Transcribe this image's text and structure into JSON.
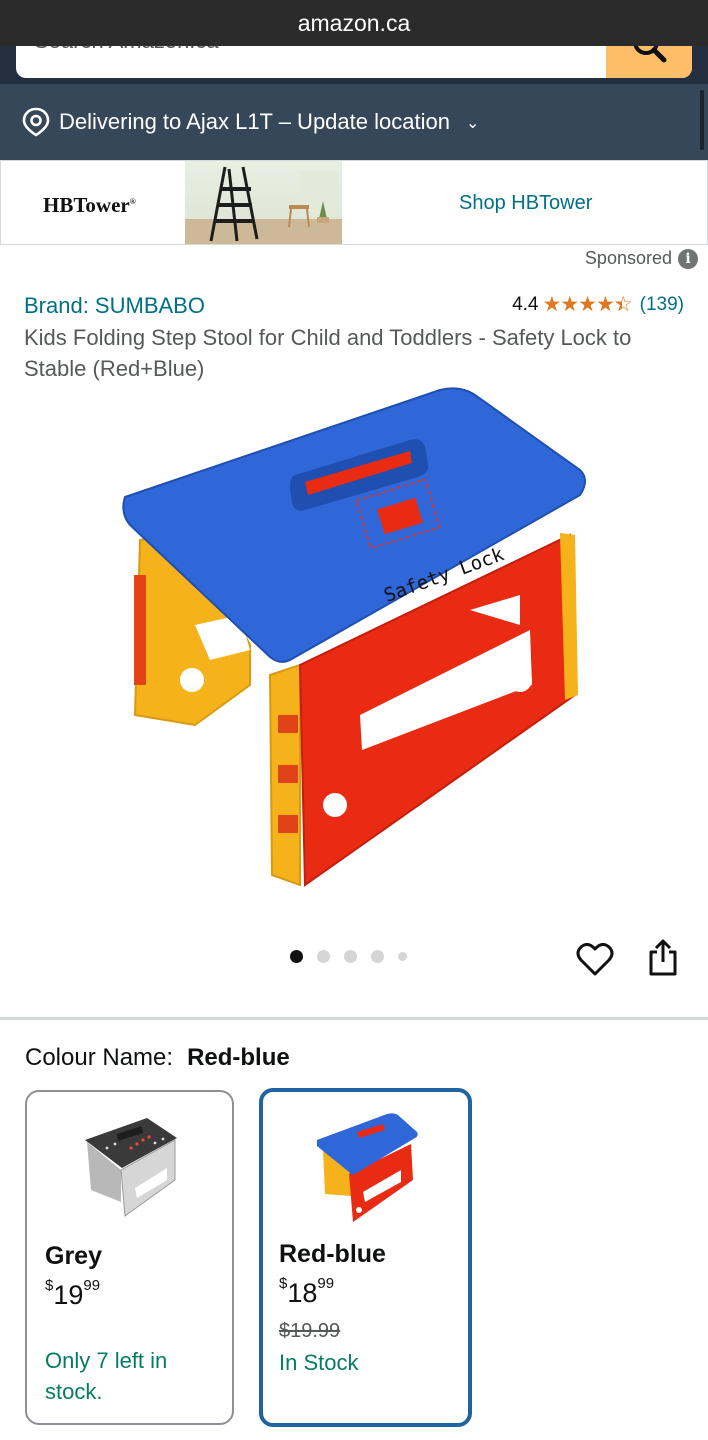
{
  "browser": {
    "url": "amazon.ca"
  },
  "search": {
    "placeholder": "Search Amazon.ca"
  },
  "delivery": {
    "text": "Delivering to Ajax L1T – Update location"
  },
  "ad": {
    "logo_text": "HBTower",
    "shop_link": "Shop HBTower",
    "sponsored_label": "Sponsored"
  },
  "product": {
    "brand": "Brand: SUMBABO",
    "rating_value": "4.4",
    "rating_stars": 4.4,
    "rating_count": "(139)",
    "title": "Kids Folding Step Stool for Child and Toddlers - Safety Lock to Stable (Red+Blue)",
    "image_caption": "Safety Lock",
    "image_count": 5,
    "active_image": 1
  },
  "colour": {
    "label": "Colour Name:",
    "selected": "Red-blue",
    "options": [
      {
        "name": "Grey",
        "price_symbol": "$",
        "price_whole": "19",
        "price_fraction": "99",
        "list_price": "",
        "stock": "Only 7 left in stock."
      },
      {
        "name": "Red-blue",
        "price_symbol": "$",
        "price_whole": "18",
        "price_fraction": "99",
        "list_price": "$19.99",
        "stock": "In Stock"
      }
    ]
  },
  "colors": {
    "link": "#007185",
    "nav_dark": "#232f3e",
    "nav_mid": "#37475a",
    "search_button": "#febd69",
    "star": "#de7921",
    "in_stock": "#067d62",
    "selected_border": "#2162a1"
  },
  "icons": [
    "location-pin-icon",
    "search-icon",
    "info-icon",
    "heart-icon",
    "share-icon"
  ]
}
